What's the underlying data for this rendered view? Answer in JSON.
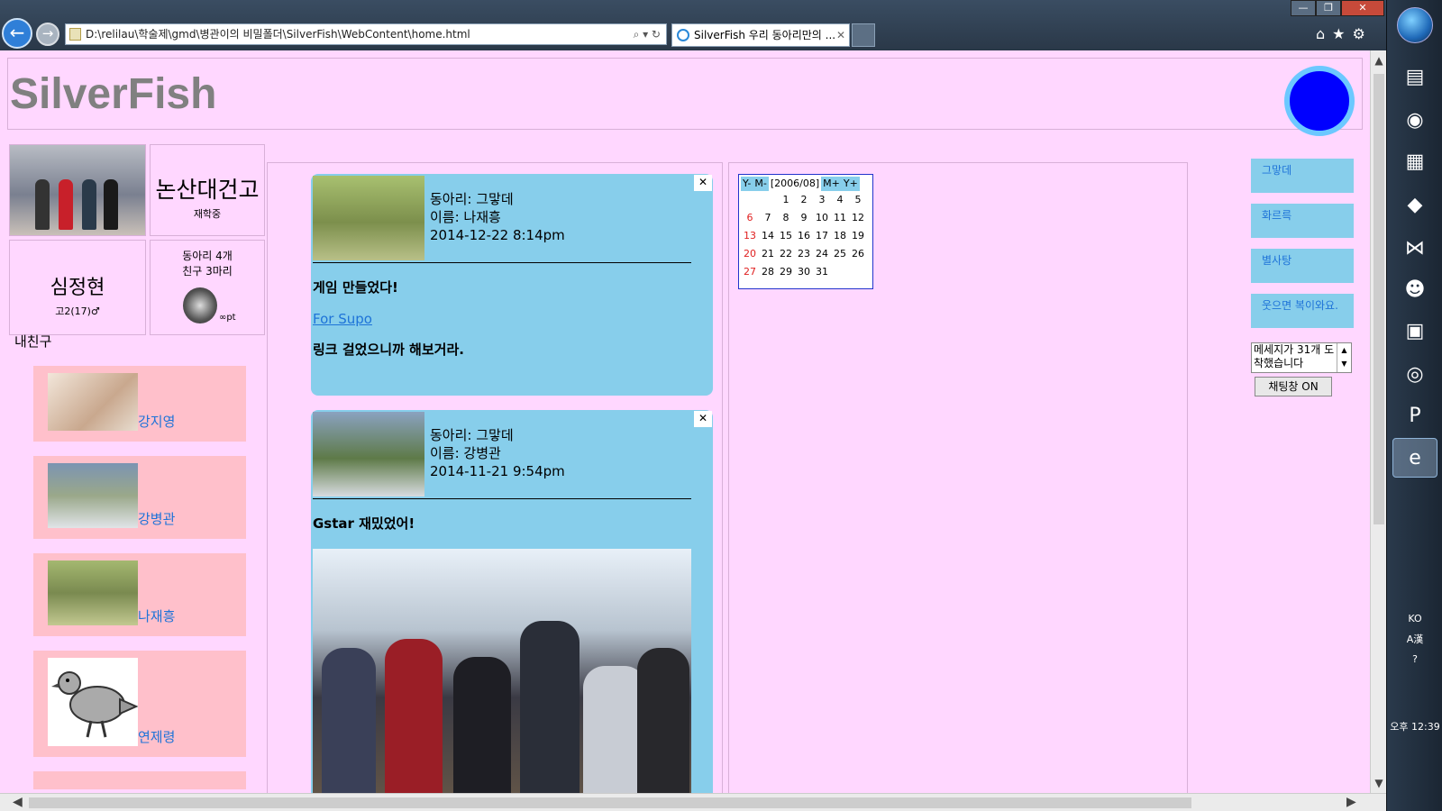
{
  "browser": {
    "address": "D:\\relilau\\학술제\\gmd\\병관이의 비밀폴더\\SilverFish\\WebContent\\home.html",
    "address_tools": "⌕ ▾ ↻",
    "tab_title": "SilverFish 우리 동아리만의 ...",
    "tab_close": "✕",
    "back": "←",
    "forward": "→",
    "window_controls": [
      "—",
      "❐",
      "✕"
    ],
    "toolbar_icons": "⌂★⚙"
  },
  "header": {
    "title": "SilverFish",
    "status_color": "#0000ff"
  },
  "profile": {
    "school_name": "논산대건고",
    "school_status": "재학중",
    "user_name": "심정현",
    "user_grade": "고2(17)♂",
    "club_count": "동아리 4개",
    "friend_count": "친구 3마리",
    "points": "∞pt"
  },
  "friends": {
    "label": "내친구",
    "items": [
      {
        "name": "강지영",
        "thumb": "#d9c8b8"
      },
      {
        "name": "강병관",
        "thumb": "#8fa8c4"
      },
      {
        "name": "나재흥",
        "thumb": "#8fa860"
      },
      {
        "name": "연제령",
        "thumb": "#ffffff"
      }
    ]
  },
  "posts": [
    {
      "club": "동아리: 그맣데",
      "name": "이름: 나재흥",
      "date": "2014-12-22 8:14pm",
      "title": "게임 만들었다!",
      "link": "For Supo",
      "body": "링크 걸었으니까 해보거라.",
      "close": "✕"
    },
    {
      "club": "동아리: 그맣데",
      "name": "이름: 강병관",
      "date": "2014-11-21 9:54pm",
      "title": "Gstar 재밌었어!",
      "close": "✕"
    }
  ],
  "calendar": {
    "nav_prev_year": "Y-",
    "nav_prev_month": "M-",
    "month": "[2006/08]",
    "nav_next_month": "M+",
    "nav_next_year": "Y+",
    "weeks": [
      [
        "",
        "",
        "1",
        "2",
        "3",
        "4",
        "5"
      ],
      [
        "6",
        "7",
        "8",
        "9",
        "10",
        "11",
        "12"
      ],
      [
        "13",
        "14",
        "15",
        "16",
        "17",
        "18",
        "19"
      ],
      [
        "20",
        "21",
        "22",
        "23",
        "24",
        "25",
        "26"
      ],
      [
        "27",
        "28",
        "29",
        "30",
        "31",
        "",
        ""
      ]
    ]
  },
  "right_nav": [
    "그맣데",
    "화르륵",
    "별사탕",
    "웃으면 복이와요."
  ],
  "message_box": "메세지가 31개 도착했습니다",
  "chat_button": "채팅창 ON",
  "taskbar": {
    "tray_lang": "KO",
    "tray_ime": "A漢",
    "tray_help": "?",
    "clock": "오후 12:39"
  }
}
